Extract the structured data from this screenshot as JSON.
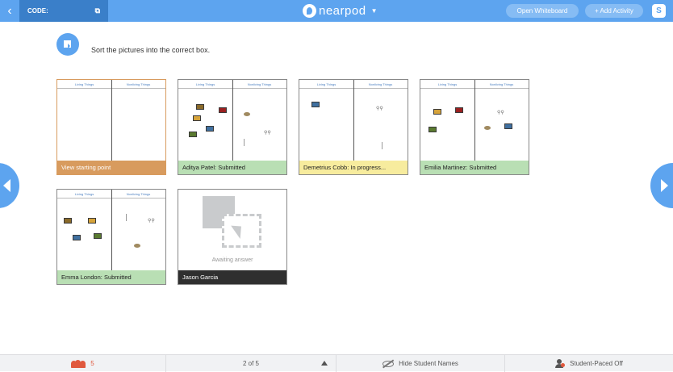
{
  "topbar": {
    "code_label": "CODE:",
    "logo_text": "nearpod",
    "open_whiteboard": "Open Whiteboard",
    "add_activity": "+ Add Activity",
    "app_icon_letter": "S",
    "back_icon": "chevron-left-icon",
    "external_icon": "external-link-icon"
  },
  "prompt": {
    "text": "Sort the pictures into the correct box."
  },
  "board_headers": {
    "left": "Living Things",
    "right": "Nonliving Things"
  },
  "cards": [
    {
      "label": "View starting point",
      "status": "starting-point"
    },
    {
      "label": "Aditya Patel: Submitted",
      "status": "submitted"
    },
    {
      "label": "Demetrius Cobb: In progress...",
      "status": "in-progress"
    },
    {
      "label": "Emilia Martinez: Submitted",
      "status": "submitted"
    },
    {
      "label": "Emma London: Submitted",
      "status": "submitted"
    },
    {
      "label": "Jason Garcia",
      "status": "awaiting",
      "awaiting_text": "Awaiting answer"
    }
  ],
  "bottombar": {
    "student_count": "5",
    "page_indicator": "2 of 5",
    "hide_names": "Hide Student Names",
    "student_paced": "Student-Paced Off"
  },
  "colors": {
    "brand_blue": "#5da4ef",
    "submitted_green": "#b9dfb4",
    "in_progress_yellow": "#f7ec9e",
    "starting_orange": "#d89b5e",
    "awaiting_dark": "#2f2f2f",
    "students_red": "#e0593e"
  }
}
